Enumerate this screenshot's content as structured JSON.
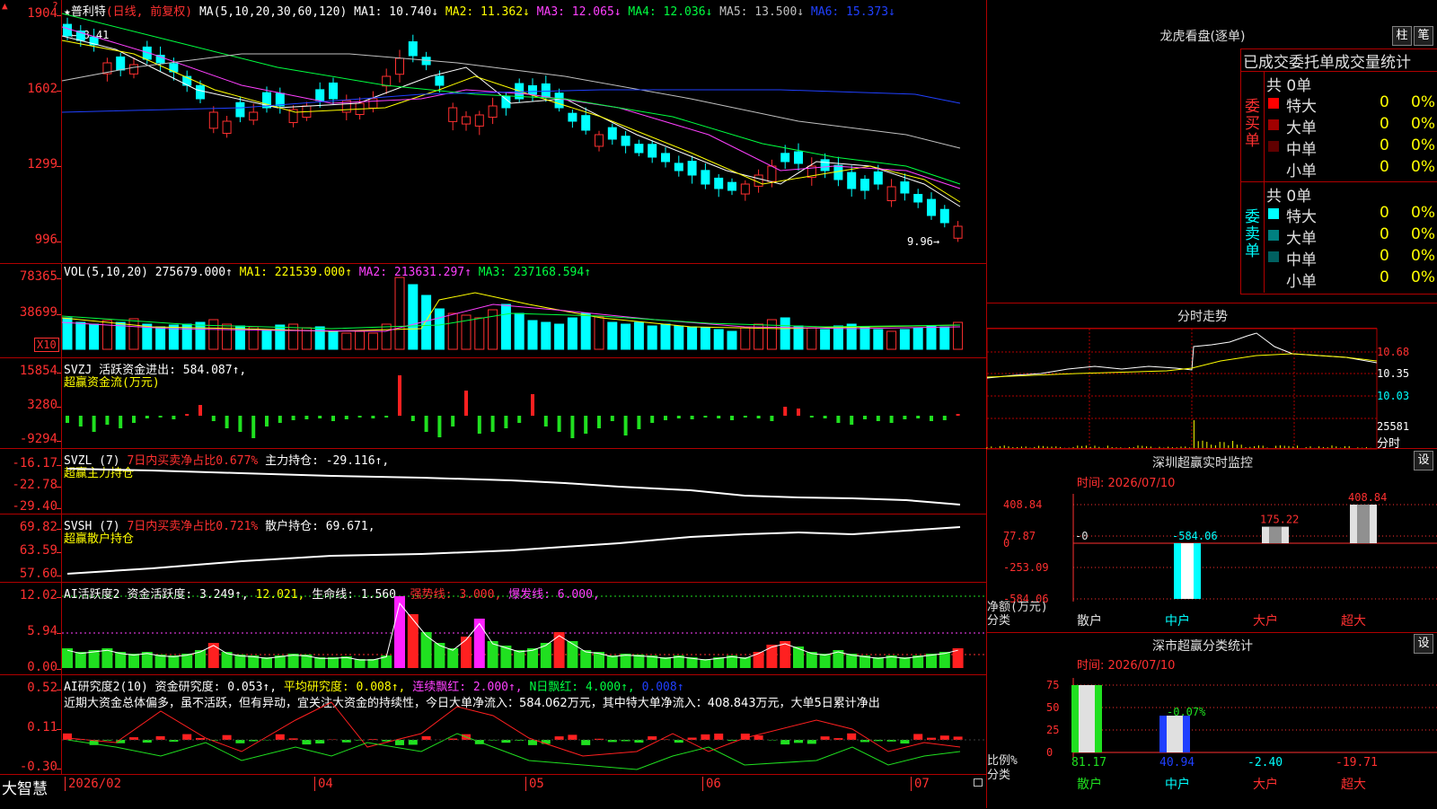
{
  "main": {
    "corner_marks": [
      "▲",
      "?"
    ],
    "header": {
      "stock": "★普利特",
      "period": "(日线, 前复权)",
      "ma_def": "MA(5,10,20,30,60,120)",
      "ma1": "MA1: 10.740↓",
      "ma2": "MA2: 11.362↓",
      "ma3": "MA3: 12.065↓",
      "ma4": "MA4: 12.036↓",
      "ma5": "MA5: 13.500↓",
      "ma6": "MA6: 15.373↓"
    },
    "y_labels": [
      "1904",
      "1602",
      "1299",
      "996"
    ],
    "high_label": "18.41",
    "low_label": "9.96"
  },
  "vol": {
    "header": {
      "name": "VOL(5,10,20)",
      "val": "275679.000↑",
      "ma1": "MA1: 221539.000↑",
      "ma2": "MA2: 213631.297↑",
      "ma3": "MA3: 237168.594↑"
    },
    "y_labels": [
      "78365",
      "38699"
    ],
    "unit": "X10"
  },
  "svzj": {
    "header": {
      "name": "SVZJ",
      "item": "活跃资金进出: 584.087↑,",
      "sub": "超赢资金流(万元)"
    },
    "y_labels": [
      "15854",
      "3280",
      "-9294"
    ]
  },
  "svzl": {
    "header": {
      "name": "SVZL (7)",
      "item1": "7日内买卖净占比0.677%",
      "item2": "主力持仓: -29.116↑,",
      "sub": "超赢主力持仓"
    },
    "y_labels": [
      "-16.17",
      "-22.78",
      "-29.40"
    ]
  },
  "svsh": {
    "header": {
      "name": "SVSH (7)",
      "item1": "7日内买卖净占比0.721%",
      "item2": "散户持仓: 69.671,",
      "sub": "超赢散户持仓"
    },
    "y_labels": [
      "69.82",
      "63.59",
      "57.60"
    ]
  },
  "ai_active": {
    "header": {
      "name": "AI活跃度2",
      "item1": "资金活跃度: 3.249↑,",
      "item2": "12.021,",
      "item3": "生命线: 1.560,",
      "item4": "强势线: 3.000,",
      "item5": "爆发线: 6.000,"
    },
    "y_labels": [
      "12.02",
      "5.94",
      "0.00"
    ]
  },
  "ai_research": {
    "header": {
      "name": "AI研究度2(10)",
      "item1": "资金研究度: 0.053↑,",
      "item2": "平均研究度: 0.008↑,",
      "item3": "连续飘红: 2.000↑,",
      "item4": "N日飘红: 4.000↑,",
      "item5": "0.008↑"
    },
    "comment": "近期大资金总体偏多，虽不活跃，但有异动，宜关注大资金的持续性，今日大单净流入：584.062万元，其中特大单净流入：408.843万元，大单5日累计净出",
    "y_labels": [
      "0.52",
      "0.11",
      "-0.30"
    ]
  },
  "bottom": {
    "app_name": "大智慧",
    "dates": [
      "2026/02",
      "04",
      "05",
      "06",
      "07"
    ]
  },
  "right": {
    "lhb_title": "龙虎看盘(逐单)",
    "btn_bar": "柱",
    "btn_pen": "笔",
    "table_title": "已成交委托单成交量统计",
    "buy_label": "委买单",
    "sell_label": "委卖单",
    "buy_total": "共 0单",
    "sell_total": "共 0单",
    "buy_rows": [
      {
        "label": "特大",
        "count": "0",
        "pct": "0%",
        "color": "#ff0000"
      },
      {
        "label": "大单",
        "count": "0",
        "pct": "0%",
        "color": "#a00000"
      },
      {
        "label": "中单",
        "count": "0",
        "pct": "0%",
        "color": "#600000"
      },
      {
        "label": "小单",
        "count": "0",
        "pct": "0%",
        "color": "#000000"
      }
    ],
    "sell_rows": [
      {
        "label": "特大",
        "count": "0",
        "pct": "0%",
        "color": "#00ffff"
      },
      {
        "label": "大单",
        "count": "0",
        "pct": "0%",
        "color": "#008080"
      },
      {
        "label": "中单",
        "count": "0",
        "pct": "0%",
        "color": "#006060"
      },
      {
        "label": "小单",
        "count": "0",
        "pct": "0%",
        "color": "#000000"
      }
    ],
    "fenshi_title": "分时走势",
    "fenshi_y": [
      "10.68",
      "10.35",
      "10.03",
      "25581"
    ],
    "fenshi_unit": "分时",
    "monitor_title": "深圳超赢实时监控",
    "monitor_btn": "设",
    "monitor_time": "时间: 2026/07/10",
    "monitor_y": [
      "408.84",
      "77.87",
      "0",
      "-253.09",
      "-584.06"
    ],
    "monitor_ylabel": "净额(万元)",
    "monitor_xlabel": "分类",
    "monitor_cats": [
      "散户",
      "中户",
      "大户",
      "超大"
    ],
    "monitor_vals": [
      "-0",
      "-584.06",
      "175.22",
      "408.84"
    ],
    "class_title": "深市超赢分类统计",
    "class_btn": "设",
    "class_time": "时间: 2026/07/10",
    "class_y": [
      "75",
      "50",
      "25",
      "0"
    ],
    "class_ylabel": "比例%",
    "class_xlabel": "分类",
    "class_cats": [
      "散户",
      "中户",
      "大户",
      "超大"
    ],
    "class_vals": [
      "81.17",
      "40.94",
      "-2.40",
      "-19.71"
    ],
    "class_top_label": "-0.07%"
  },
  "colors": {
    "up": "#ff3030",
    "down": "#00ffff",
    "ma1": "#ffffff",
    "ma2": "#ffff00",
    "ma3": "#ff40ff",
    "ma4": "#00ff40",
    "ma5": "#c0c0c0",
    "ma6": "#2040ff",
    "grid": "#b00000"
  }
}
